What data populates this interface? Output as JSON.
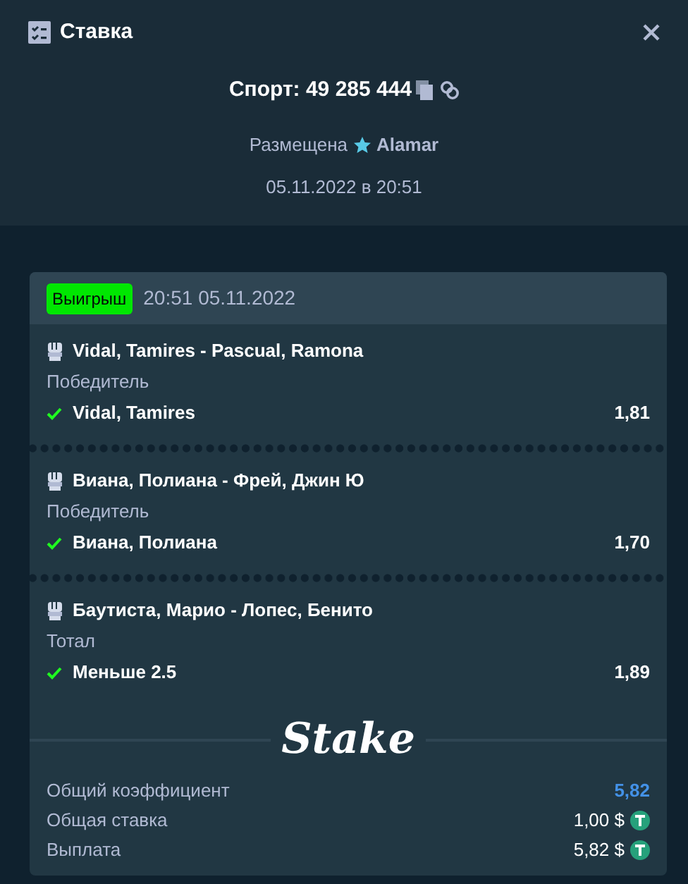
{
  "window": {
    "title": "Ставка"
  },
  "bet": {
    "label": "Спорт: 49 285 444",
    "placed_label": "Размещена",
    "user": "Alamar",
    "date": "05.11.2022 в 20:51"
  },
  "slip": {
    "status": {
      "kind": "win",
      "label": "Выигрыш"
    },
    "time": "20:51 05.11.2022",
    "legs": [
      {
        "event": "Vidal, Tamires - Pascual, Ramona",
        "market": "Победитель",
        "outcome": "Vidal, Tamires",
        "odds": "1,81",
        "won": true
      },
      {
        "event": "Виана, Полиана - Фрей, Джин Ю",
        "market": "Победитель",
        "outcome": "Виана, Полиана",
        "odds": "1,70",
        "won": true
      },
      {
        "event": "Баутиста, Марио - Лопес, Бенито",
        "market": "Тотал",
        "outcome": "Меньше 2.5",
        "odds": "1,89",
        "won": true
      }
    ],
    "logo": "Stake",
    "summary": [
      {
        "kind": "odds",
        "label": "Общий коэффициент",
        "value": "5,82"
      },
      {
        "kind": "money",
        "label": "Общая ставка",
        "value": "1,00 $"
      },
      {
        "kind": "money",
        "label": "Выплата",
        "value": "5,82 $"
      }
    ]
  }
}
